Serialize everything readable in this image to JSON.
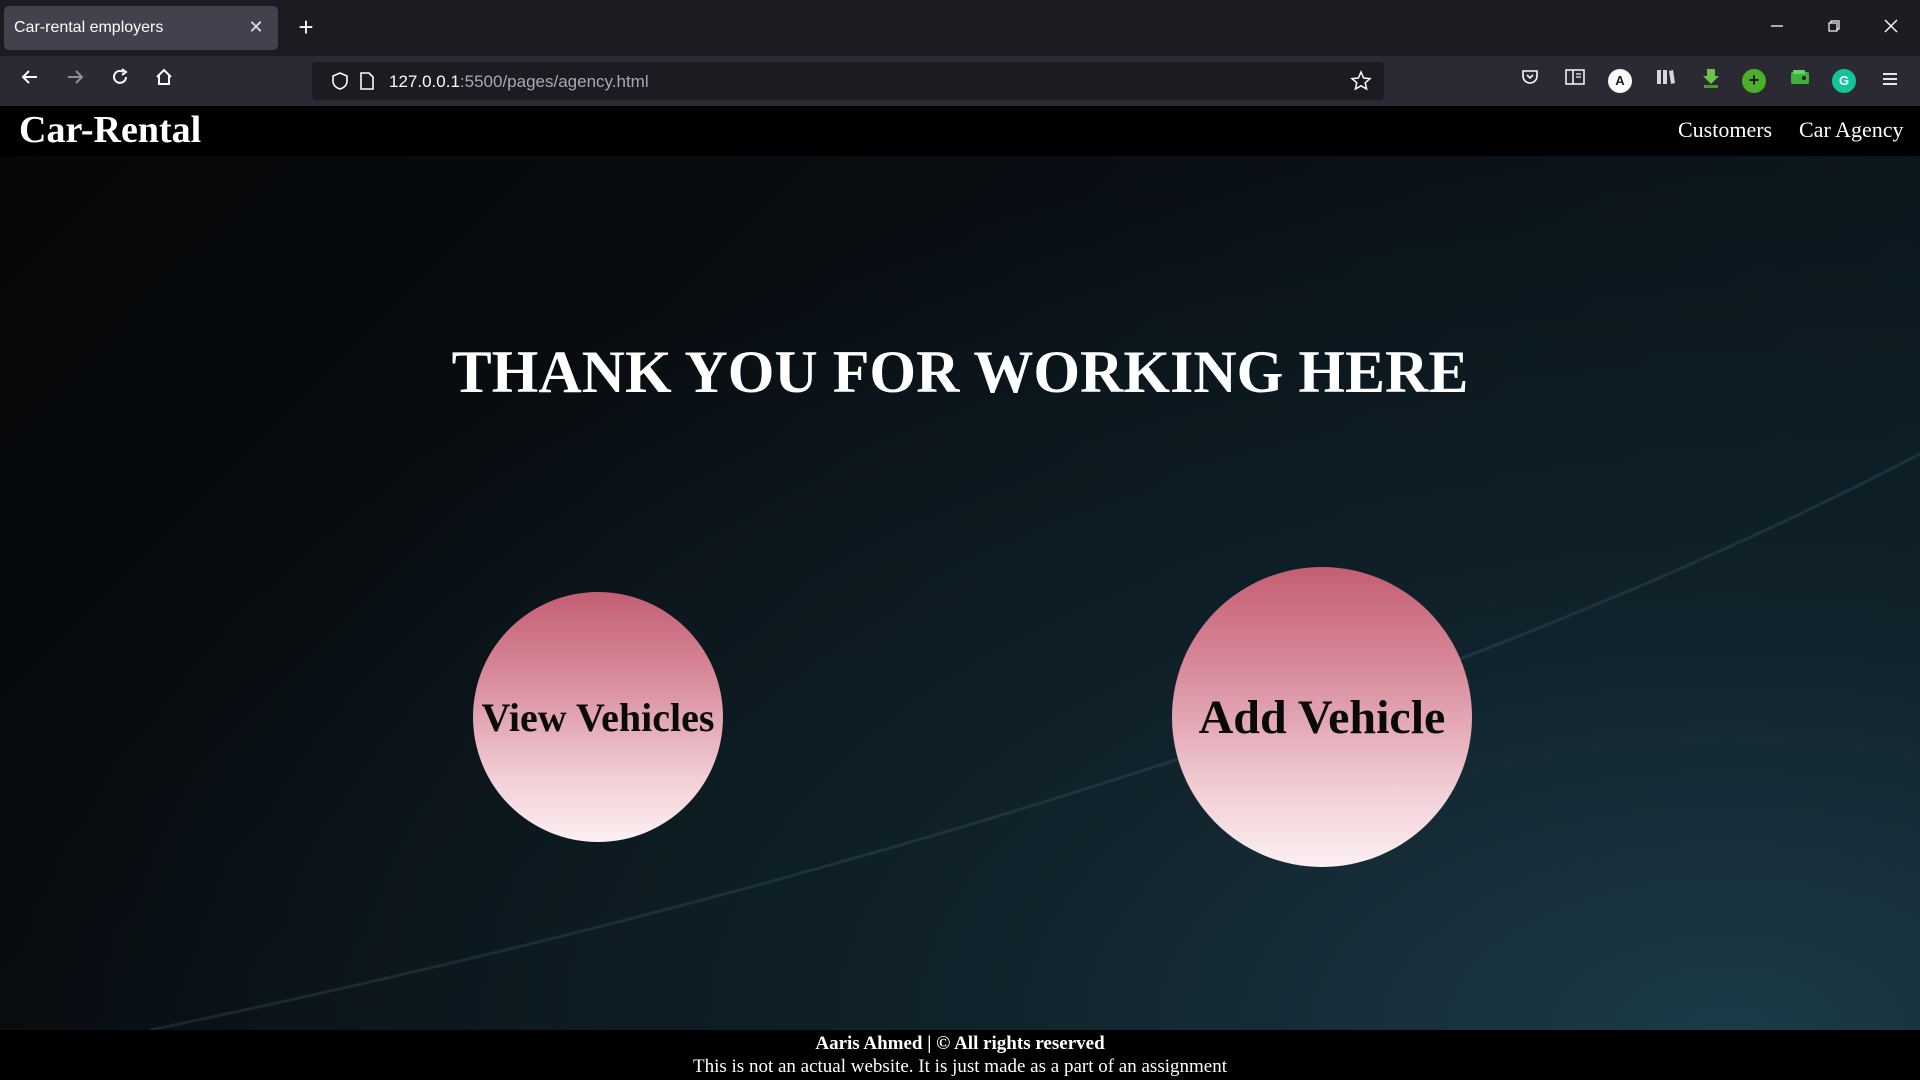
{
  "browser": {
    "tab_title": "Car-rental employers",
    "tab_close": "✕",
    "new_tab": "+",
    "url_host": "127.0.0.1",
    "url_path": ":5500/pages/agency.html",
    "extensions": {
      "account_letter": "A"
    }
  },
  "site": {
    "brand": "Car-Rental",
    "nav": {
      "customers": "Customers",
      "car_agency": "Car Agency"
    },
    "hero_title": "THANK YOU FOR WORKING HERE",
    "buttons": {
      "view_vehicles": "View Vehicles",
      "add_vehicle": "Add Vehicle"
    },
    "footer": {
      "line1": "Aaris Ahmed | © All rights reserved",
      "line2": "This is not an actual website. It is just made as a part of an assignment"
    }
  },
  "colors": {
    "button_gradient_top": "#c45e73",
    "button_gradient_bottom": "#fcf0f2",
    "header_bg": "#000000",
    "page_bg": "#0a1218"
  }
}
